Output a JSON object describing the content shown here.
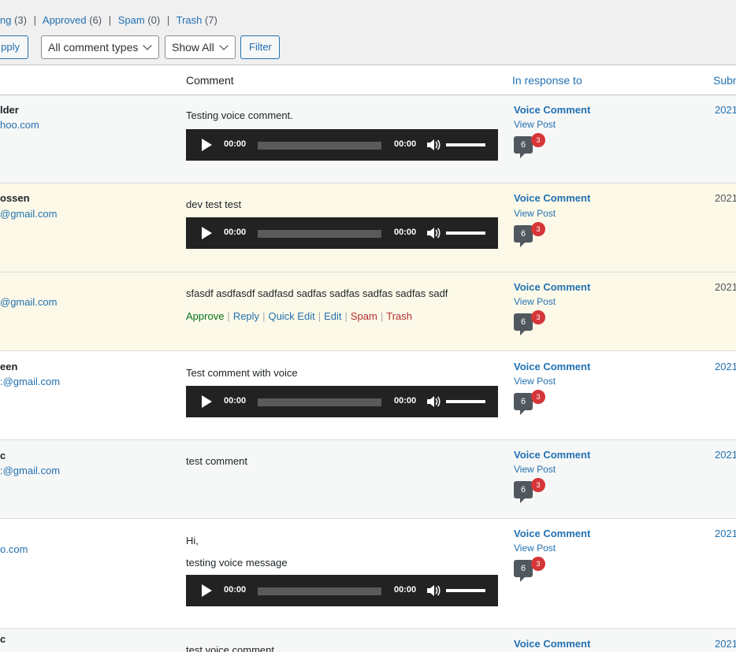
{
  "views": {
    "pending_label": "ng",
    "pending_count": "(3)",
    "approved_label": "Approved",
    "approved_count": "(6)",
    "spam_label": "Spam",
    "spam_count": "(0)",
    "trash_label": "Trash",
    "trash_count": "(7)",
    "separator": "|"
  },
  "tablenav": {
    "apply_label": "pply",
    "comment_type_selected": "All comment types",
    "show_selected": "Show All",
    "filter_label": "Filter"
  },
  "columns": {
    "comment": "Comment",
    "in_response_to": "In response to",
    "submitted": "Subm"
  },
  "row_actions": {
    "approve": "Approve",
    "reply": "Reply",
    "quick_edit": "Quick Edit",
    "edit": "Edit",
    "spam": "Spam",
    "trash": "Trash",
    "separator": "|"
  },
  "player": {
    "time_current": "00:00",
    "time_duration": "00:00"
  },
  "rows": [
    {
      "author": "lder",
      "email": "hoo.com",
      "comment": "Testing voice comment.",
      "response_title": "Voice Comment",
      "view_post": "View Post",
      "comment_count": "6",
      "pending_count": "3",
      "date": "2021"
    },
    {
      "author": "ossen",
      "email": "@gmail.com",
      "comment": "dev test test",
      "response_title": "Voice Comment",
      "view_post": "View Post",
      "comment_count": "6",
      "pending_count": "3",
      "date": "2021"
    },
    {
      "author": "",
      "email": "@gmail.com",
      "comment": "sfasdf asdfasdf sadfasd sadfas sadfas sadfas sadfas sadf",
      "response_title": "Voice Comment",
      "view_post": "View Post",
      "comment_count": "6",
      "pending_count": "3",
      "date": "2021"
    },
    {
      "author": "een",
      "email": ":@gmail.com",
      "comment": "Test comment with voice",
      "response_title": "Voice Comment",
      "view_post": "View Post",
      "comment_count": "6",
      "pending_count": "3",
      "date": "2021"
    },
    {
      "author": "c",
      "email": ":@gmail.com",
      "comment": "test comment",
      "response_title": "Voice Comment",
      "view_post": "View Post",
      "comment_count": "6",
      "pending_count": "3",
      "date": "2021"
    },
    {
      "author": "",
      "email": "o.com",
      "comment_line1": "Hi,",
      "comment_line2": "testing voice message",
      "response_title": "Voice Comment",
      "view_post": "View Post",
      "comment_count": "6",
      "pending_count": "3",
      "date": "2021"
    },
    {
      "author": "c",
      "email": "",
      "comment": "test voice comment",
      "response_title": "Voice Comment",
      "date": "2021"
    }
  ]
}
